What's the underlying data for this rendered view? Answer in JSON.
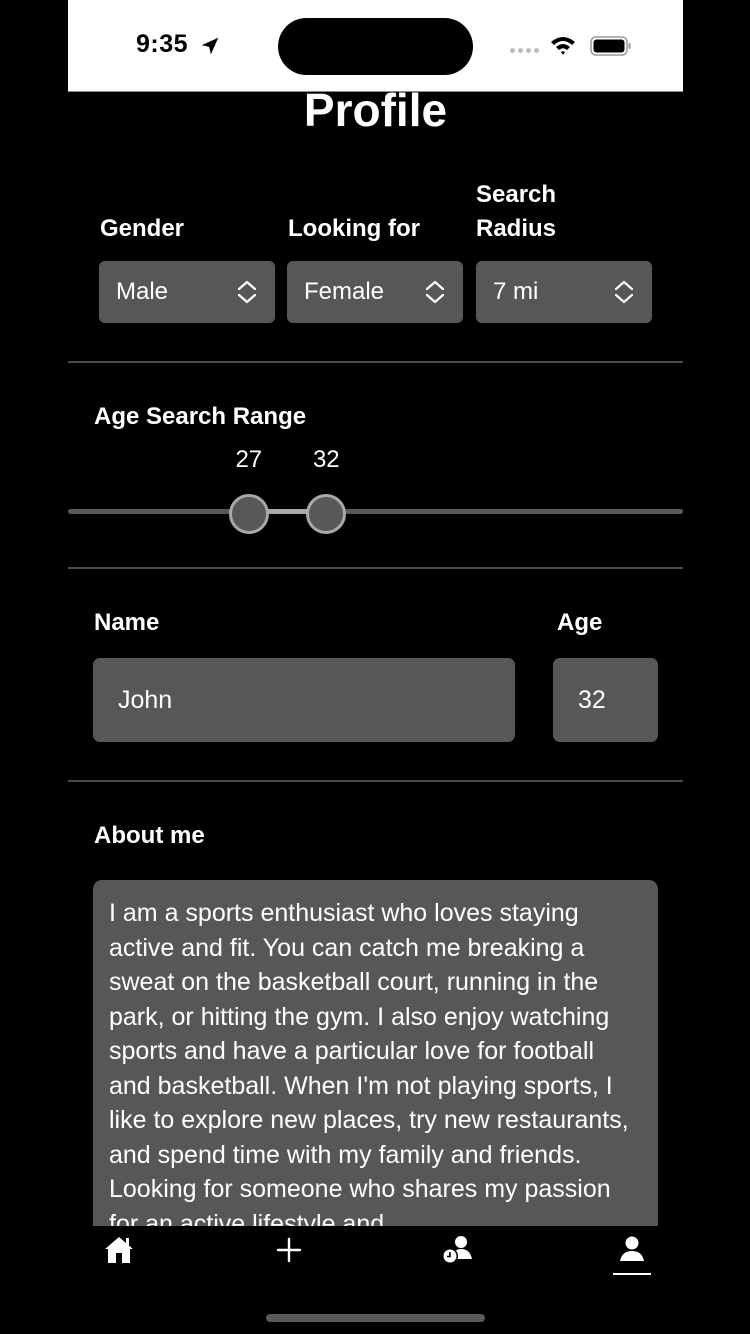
{
  "status_bar": {
    "time": "9:35",
    "icons": [
      "location-arrow-icon",
      "cellular-signal-icon",
      "wifi-icon",
      "battery-icon"
    ]
  },
  "page": {
    "title": "Profile"
  },
  "preferences": {
    "gender": {
      "label": "Gender",
      "value": "Male"
    },
    "looking_for": {
      "label": "Looking for",
      "value": "Female"
    },
    "search_radius": {
      "label_line1": "Search",
      "label_line2": "Radius",
      "value": "7 mi"
    }
  },
  "age_range": {
    "label": "Age Search Range",
    "min_label": "27",
    "max_label": "32",
    "min_value": 27,
    "max_value": 32,
    "lower_fraction": 0.294,
    "upper_fraction": 0.42
  },
  "identity": {
    "name_label": "Name",
    "name_value": "John",
    "age_label": "Age",
    "age_value": "32"
  },
  "about": {
    "label": "About me",
    "text": "I am a sports enthusiast who loves staying active and fit. You can catch me breaking a sweat on the basketball court, running in the park, or hitting the gym. I also enjoy watching sports and have a particular love for football and basketball. When I'm not playing sports, I like to explore new places, try new restaurants, and spend time with my family and friends. Looking for someone who shares my passion for an active lifestyle and"
  },
  "tab_bar": {
    "tabs": [
      {
        "name": "home",
        "icon": "home-icon",
        "active": false
      },
      {
        "name": "add",
        "icon": "plus-icon",
        "active": false
      },
      {
        "name": "pending",
        "icon": "person-clock-icon",
        "active": false
      },
      {
        "name": "profile",
        "icon": "person-icon",
        "active": true
      }
    ]
  }
}
